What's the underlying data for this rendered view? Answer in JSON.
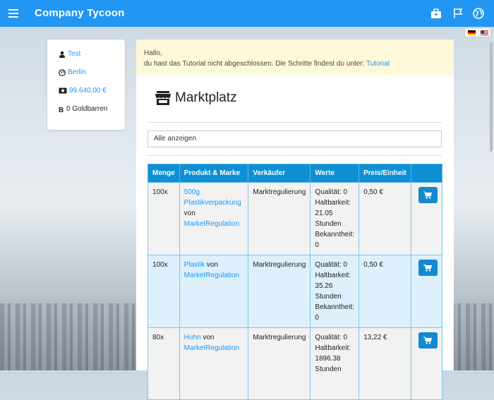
{
  "header": {
    "brand": "Company Tycoon",
    "icons": [
      "briefcase-icon",
      "flag-icon",
      "globe-icon"
    ]
  },
  "languages": [
    "de",
    "en-us"
  ],
  "sidebar": {
    "user": "Test",
    "city": "Berlin",
    "money": "99.640,00 €",
    "gold": "0 Goldbarren"
  },
  "alert": {
    "line1": "Hallo,",
    "line2": "du hast das Tutorial nicht abgeschlossen. Die Schritte findest du unter: ",
    "link": "Tutorial"
  },
  "marketplace": {
    "title": "Marktplatz",
    "filter": "Alle anzeigen",
    "columns": [
      "Menge",
      "Produkt & Marke",
      "Verkäufer",
      "Werte",
      "Preis/Einheit",
      ""
    ],
    "rows": [
      {
        "qty": "100x",
        "product": "500g Plastikverpackung",
        "by": "von",
        "brand": "MarketRegulation",
        "seller": "Marktregulierung",
        "values": [
          "Qualität: 0",
          "Haltbarkeit: 21.05 Stunden",
          "Bekanntheit: 0"
        ],
        "price": "0,50 €"
      },
      {
        "qty": "100x",
        "product": "Plastik",
        "by": "von",
        "brand": "MarketRegulation",
        "seller": "Marktregulierung",
        "values": [
          "Qualität: 0",
          "Haltbarkeit: 35.26 Stunden",
          "Bekanntheit: 0"
        ],
        "price": "0,50 €"
      },
      {
        "qty": "80x",
        "product": "Huhn",
        "by": "von",
        "brand": "MarketRegulation",
        "seller": "Marktregulierung",
        "values": [
          "Qualität: 0",
          "Haltbarkeit: 1896.38 Stunden"
        ],
        "price": "13,22 €"
      }
    ]
  }
}
